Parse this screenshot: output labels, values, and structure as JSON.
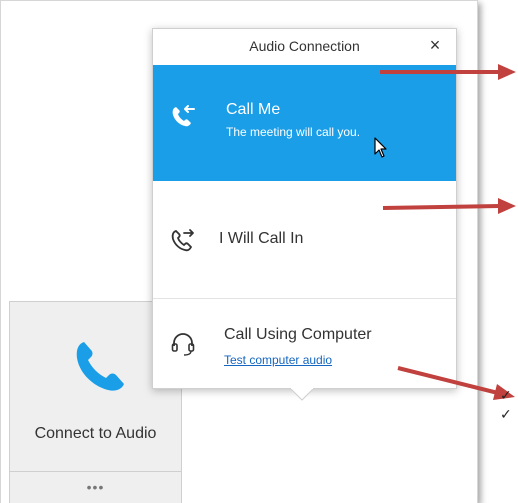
{
  "dialog": {
    "title": "Audio Connection",
    "close_label": "×"
  },
  "options": {
    "call_me": {
      "title": "Call Me",
      "subtitle": "The meeting will call you.",
      "icon": "call-me-icon"
    },
    "call_in": {
      "title": "I Will Call In",
      "icon": "call-in-icon"
    },
    "computer": {
      "title": "Call Using Computer",
      "link": "Test computer audio",
      "icon": "headset-icon"
    }
  },
  "connect_panel": {
    "label": "Connect to Audio",
    "more_label": "•••",
    "icon": "phone-icon"
  },
  "annotations": {
    "checkmarks": [
      "✓",
      "✓"
    ]
  },
  "colors": {
    "selected_bg": "#1a9ee8",
    "phone_icon": "#1a9ee8",
    "link": "#1566c0",
    "arrow": "#c0413d"
  }
}
